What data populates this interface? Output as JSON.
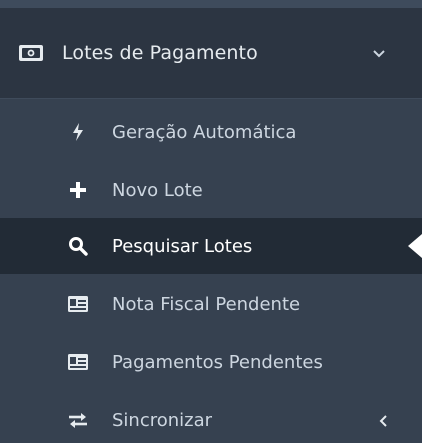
{
  "sidebar": {
    "section": {
      "label": "Lotes de Pagamento",
      "icon": "money-bill-icon",
      "expanded": true
    },
    "items": [
      {
        "label": "Geração Automática",
        "icon": "bolt-icon",
        "active": false
      },
      {
        "label": "Novo Lote",
        "icon": "plus-icon",
        "active": false
      },
      {
        "label": "Pesquisar Lotes",
        "icon": "search-icon",
        "active": true
      },
      {
        "label": "Nota Fiscal Pendente",
        "icon": "id-card-icon",
        "active": false
      },
      {
        "label": "Pagamentos Pendentes",
        "icon": "id-card-icon",
        "active": false
      },
      {
        "label": "Sincronizar",
        "icon": "exchange-icon",
        "active": false,
        "has_submenu": true
      }
    ]
  },
  "colors": {
    "sidebar_bg": "#364150",
    "header_bg": "#2c3542",
    "active_bg": "#222b36",
    "text": "#cdd6e0",
    "active_text": "#ffffff"
  }
}
